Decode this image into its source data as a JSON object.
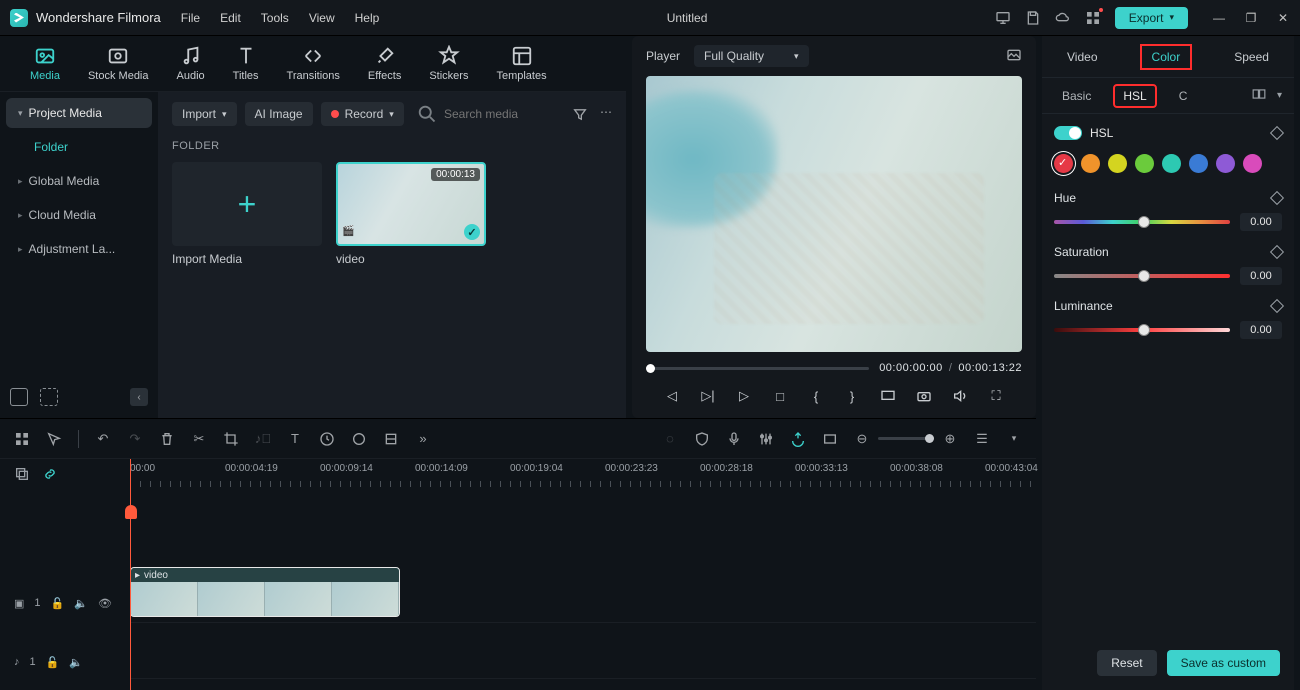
{
  "app_name": "Wondershare Filmora",
  "menu": [
    "File",
    "Edit",
    "Tools",
    "View",
    "Help"
  ],
  "doc_title": "Untitled",
  "export": "Export",
  "main_tabs": [
    {
      "label": "Media",
      "active": true
    },
    {
      "label": "Stock Media"
    },
    {
      "label": "Audio"
    },
    {
      "label": "Titles"
    },
    {
      "label": "Transitions"
    },
    {
      "label": "Effects"
    },
    {
      "label": "Stickers"
    },
    {
      "label": "Templates"
    }
  ],
  "side": {
    "project_media": "Project Media",
    "folder": "Folder",
    "global": "Global Media",
    "cloud": "Cloud Media",
    "adjust": "Adjustment La..."
  },
  "media_toolbar": {
    "import": "Import",
    "ai": "AI Image",
    "record": "Record",
    "search_ph": "Search media"
  },
  "folder_label": "FOLDER",
  "thumbs": {
    "import_media": "Import Media",
    "video": "video",
    "duration": "00:00:13"
  },
  "preview": {
    "player": "Player",
    "quality": "Full Quality",
    "cur": "00:00:00:00",
    "total": "00:00:13:22"
  },
  "rp": {
    "tabs": [
      "Video",
      "Color",
      "Speed"
    ],
    "subtabs": [
      "Basic",
      "HSL",
      "C"
    ],
    "hsl": "HSL",
    "swatches": [
      "#e63946",
      "#f0932b",
      "#d4d420",
      "#6bcb3c",
      "#2dc9b2",
      "#3a7bd5",
      "#8e5ad6",
      "#d94bbb"
    ],
    "hue": {
      "label": "Hue",
      "val": "0.00"
    },
    "sat": {
      "label": "Saturation",
      "val": "0.00"
    },
    "lum": {
      "label": "Luminance",
      "val": "0.00"
    }
  },
  "footer": {
    "reset": "Reset",
    "save": "Save as custom"
  },
  "ruler": [
    "00:00",
    "00:00:04:19",
    "00:00:09:14",
    "00:00:14:09",
    "00:00:19:04",
    "00:00:23:23",
    "00:00:28:18",
    "00:00:33:13",
    "00:00:38:08",
    "00:00:43:04"
  ],
  "clip_label": "video",
  "track_v": "1",
  "track_a": "1"
}
